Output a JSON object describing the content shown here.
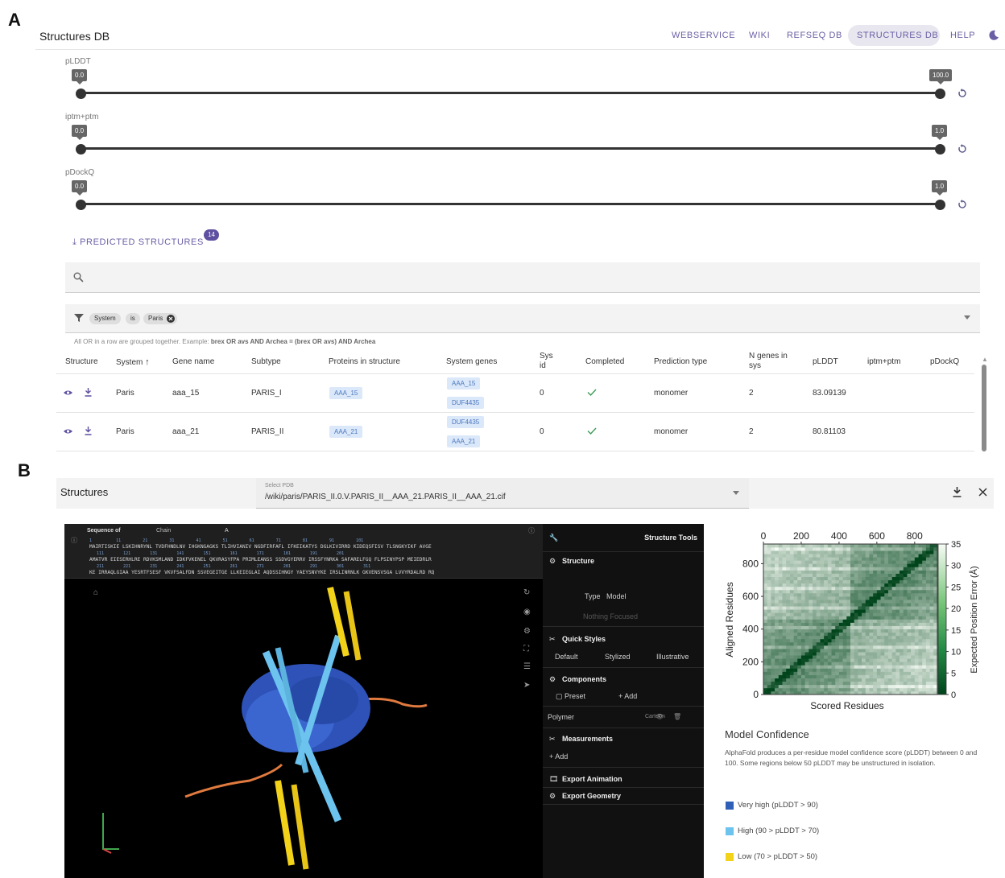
{
  "panel_labels": {
    "a": "A",
    "b": "B"
  },
  "header": {
    "title": "Structures DB",
    "nav": [
      "WEBSERVICE",
      "WIKI",
      "REFSEQ DB",
      "STRUCTURES DB",
      "HELP"
    ],
    "active": "STRUCTURES DB"
  },
  "sliders": [
    {
      "label": "pLDDT",
      "min": "0.0",
      "max": "100.0"
    },
    {
      "label": "iptm+ptm",
      "min": "0.0",
      "max": "1.0"
    },
    {
      "label": "pDockQ",
      "min": "0.0",
      "max": "1.0"
    }
  ],
  "predicted": {
    "label": "PREDICTED STRUCTURES",
    "count": "14"
  },
  "filter": {
    "field": "System",
    "op": "is",
    "value": "Paris"
  },
  "hint": {
    "pre": "All OR in a row are grouped together. Example: ",
    "bold": "brex OR avs AND Archea = (brex OR avs) AND Archea"
  },
  "table": {
    "headers": [
      "Structure",
      "System",
      "Gene name",
      "Subtype",
      "Proteins in structure",
      "System genes",
      "Sys id",
      "Completed",
      "Prediction type",
      "N genes in sys",
      "pLDDT",
      "iptm+ptm",
      "pDockQ"
    ],
    "rows": [
      {
        "system": "Paris",
        "gene": "aaa_15",
        "subtype": "PARIS_I",
        "proteins": "AAA_15",
        "sysgenes": [
          "AAA_15",
          "DUF4435"
        ],
        "sysid": "0",
        "type": "monomer",
        "ngenes": "2",
        "plddt": "83.09139"
      },
      {
        "system": "Paris",
        "gene": "aaa_21",
        "subtype": "PARIS_II",
        "proteins": "AAA_21",
        "sysgenes": [
          "DUF4435",
          "AAA_21"
        ],
        "sysid": "0",
        "type": "monomer",
        "ngenes": "2",
        "plddt": "80.81103"
      }
    ]
  },
  "structures": {
    "title": "Structures",
    "select_label": "Select PDB",
    "select_value": "/wiki/paris/PARIS_II.0.V.PARIS_II__AAA_21.PARIS_II__AAA_21.cif"
  },
  "viewer": {
    "seq_label": "Sequence of",
    "chain_label": "Chain",
    "chain_value": "A",
    "nums1": "1          11         21         31         41         51         61         71         81         91         101",
    "line1": "MAIRTISKIE LSKIHNRYNL TVDFHNDLNV IHGKNGAGKS TLIHVIANIV NGDFIRFAFL IFKEIKATYS DGLKIVIRRD KIDEQSFISV TLSNGKYIKF AVGE",
    "nums2": "   111        121        131        141        151        161        171        181        191        201",
    "line2": "AMATVR EIESERHLRE RDVKSMLAND IDKFVKENEL QKVRASYFPA PRIMLEANSS SSDVGYERRV IRSSFYNRKA SAFARELFGQ FLPSINYPSP MEIEDRLR",
    "nums3": "   211        221        231        241        251        261        271        281        291        301        311",
    "line3": "KE IRRAQLGIAA YESRTFSESF VKVFSALFDN SSVEGEITGE LLKEIEGLAI AQDSSIHNGY YAEYSNVYKE IRSLINRNLK GKVENSVSGA LVVYRDALRD RQ"
  },
  "tools": {
    "title": "Structure Tools",
    "structure": "Structure",
    "type_label": "Type",
    "type_value": "Model",
    "focus": "Nothing Focused",
    "quick_styles": "Quick Styles",
    "styles": [
      "Default",
      "Stylized",
      "Illustrative"
    ],
    "components": "Components",
    "preset": "Preset",
    "add": "+ Add",
    "polymer": "Polymer",
    "cartoon": "Cartoon",
    "measurements": "Measurements",
    "add2": "+ Add",
    "export_anim": "Export Animation",
    "export_geom": "Export Geometry"
  },
  "chart_data": {
    "type": "heatmap",
    "title": "",
    "xlabel": "Scored Residues",
    "ylabel": "Aligned Residues",
    "colorbar_label": "Expected Position Error (Å)",
    "xticks": [
      0,
      200,
      400,
      600,
      800
    ],
    "yticks": [
      0,
      200,
      400,
      600,
      800
    ],
    "cticks": [
      0,
      5,
      10,
      15,
      20,
      25,
      30,
      35
    ],
    "xlim": [
      0,
      920
    ],
    "ylim": [
      0,
      920
    ],
    "clim": [
      0,
      35
    ],
    "domain_boundaries": [
      460
    ],
    "colormap": [
      "#f7fcf5",
      "#00441b"
    ]
  },
  "confidence": {
    "title": "Model Confidence",
    "desc": "AlphaFold produces a per-residue model confidence score (pLDDT) between 0 and 100. Some regions below 50 pLDDT may be unstructured in isolation.",
    "legend": [
      {
        "label": "Very high (pLDDT > 90)",
        "color": "#2f5fb7"
      },
      {
        "label": "High (90 > pLDDT > 70)",
        "color": "#6cc3ee"
      },
      {
        "label": "Low (70 > pLDDT > 50)",
        "color": "#f3d21a"
      }
    ]
  }
}
